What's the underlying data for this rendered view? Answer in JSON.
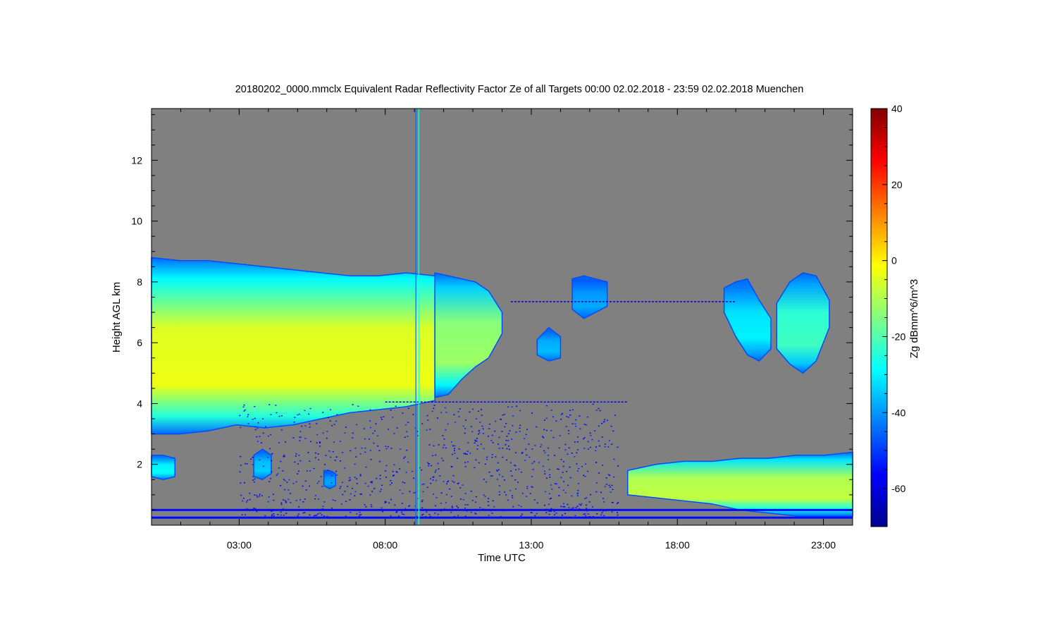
{
  "chart_data": {
    "type": "heatmap",
    "title": "20180202_0000.mmclx Equivalent Radar Reflectivity Factor Ze of all Targets   00:00 02.02.2018 - 23:59 02.02.2018 Muenchen",
    "xlabel": "Time UTC",
    "ylabel": "Height AGL km",
    "x_unit": "hours UTC",
    "xlim": [
      0.0,
      24.0
    ],
    "ylim": [
      0.0,
      13.7
    ],
    "x_ticks": [
      {
        "value": 3,
        "label": "03:00"
      },
      {
        "value": 8,
        "label": "08:00"
      },
      {
        "value": 13,
        "label": "13:00"
      },
      {
        "value": 18,
        "label": "18:00"
      },
      {
        "value": 23,
        "label": "23:00"
      }
    ],
    "y_ticks": [
      {
        "value": 2,
        "label": "2"
      },
      {
        "value": 4,
        "label": "4"
      },
      {
        "value": 6,
        "label": "6"
      },
      {
        "value": 8,
        "label": "8"
      },
      {
        "value": 10,
        "label": "10"
      },
      {
        "value": 12,
        "label": "12"
      }
    ],
    "colorbar": {
      "label": "Zg dBmm^6/m^3",
      "range": [
        -70,
        40
      ],
      "ticks": [
        {
          "value": 40,
          "label": "40"
        },
        {
          "value": 20,
          "label": "20"
        },
        {
          "value": 0,
          "label": "0"
        },
        {
          "value": -20,
          "label": "-20"
        },
        {
          "value": -40,
          "label": "-40"
        },
        {
          "value": -60,
          "label": "-60"
        }
      ]
    },
    "background_color": "#808080",
    "colormap": [
      "#00008f",
      "#0000ff",
      "#0080ff",
      "#00ffff",
      "#80ff80",
      "#ffff00",
      "#ff8000",
      "#ff0000",
      "#800000"
    ],
    "echo_regions": [
      {
        "t": [
          0.0,
          9.7
        ],
        "base": [
          3.0,
          3.0,
          3.1,
          3.3,
          3.2,
          3.3,
          3.5,
          3.7,
          3.8,
          3.9,
          4.1
        ],
        "top": [
          8.8,
          8.7,
          8.7,
          8.6,
          8.5,
          8.4,
          8.3,
          8.2,
          8.2,
          8.3,
          8.2
        ],
        "core": -5
      },
      {
        "t": [
          9.7,
          12.0
        ],
        "base": [
          4.2,
          4.3,
          4.8,
          5.2,
          5.5,
          6.3
        ],
        "top": [
          8.3,
          8.2,
          8.1,
          8.0,
          7.7,
          7.0
        ],
        "core": -14
      },
      {
        "t": [
          16.3,
          24.0
        ],
        "base": [
          1.0,
          0.9,
          0.8,
          0.7,
          0.5,
          0.4,
          0.3,
          0.3,
          0.3
        ],
        "top": [
          1.8,
          2.0,
          2.1,
          2.1,
          2.2,
          2.2,
          2.3,
          2.3,
          2.4
        ],
        "core": -10
      },
      {
        "t": [
          19.6,
          21.2
        ],
        "base": [
          7.0,
          6.2,
          5.6,
          5.4,
          5.8
        ],
        "top": [
          7.8,
          8.0,
          8.1,
          7.4,
          6.8
        ],
        "core": -32
      },
      {
        "t": [
          21.4,
          23.2
        ],
        "base": [
          5.8,
          5.3,
          5.0,
          5.4,
          6.5
        ],
        "top": [
          7.3,
          8.0,
          8.3,
          8.2,
          7.4
        ],
        "core": -24
      },
      {
        "t": [
          13.2,
          14.0
        ],
        "base": [
          5.6,
          5.4,
          5.5
        ],
        "top": [
          6.1,
          6.5,
          6.2
        ],
        "core": -38
      },
      {
        "t": [
          14.4,
          15.6
        ],
        "base": [
          7.1,
          6.8,
          7.0,
          7.2
        ],
        "top": [
          8.1,
          8.2,
          8.1,
          8.0
        ],
        "core": -40
      },
      {
        "t": [
          0.0,
          0.8
        ],
        "base": [
          1.6,
          1.5,
          1.6
        ],
        "top": [
          2.3,
          2.3,
          2.2
        ],
        "core": -30
      },
      {
        "t": [
          3.5,
          4.1
        ],
        "base": [
          1.6,
          1.5,
          1.7
        ],
        "top": [
          2.3,
          2.5,
          2.3
        ],
        "core": -36
      },
      {
        "t": [
          5.9,
          6.3
        ],
        "base": [
          1.3,
          1.2,
          1.3
        ],
        "top": [
          1.8,
          1.8,
          1.7
        ],
        "core": -40
      }
    ],
    "clutter_lines": [
      {
        "height": 0.5,
        "t": [
          0.0,
          24.0
        ],
        "value": -55
      },
      {
        "height": 0.25,
        "t": [
          0.0,
          24.0
        ],
        "value": -55
      },
      {
        "height": 4.05,
        "t": [
          8.0,
          16.3
        ],
        "value": -58
      },
      {
        "height": 7.35,
        "t": [
          12.3,
          20.0
        ],
        "value": -60
      }
    ],
    "vertical_artifacts": [
      {
        "time": 9.15,
        "value": -25
      },
      {
        "time": 9.05,
        "value": -45
      }
    ],
    "noise_region": {
      "t": [
        3.0,
        16.0
      ],
      "h": [
        0.3,
        4.0
      ],
      "value": -58
    }
  }
}
